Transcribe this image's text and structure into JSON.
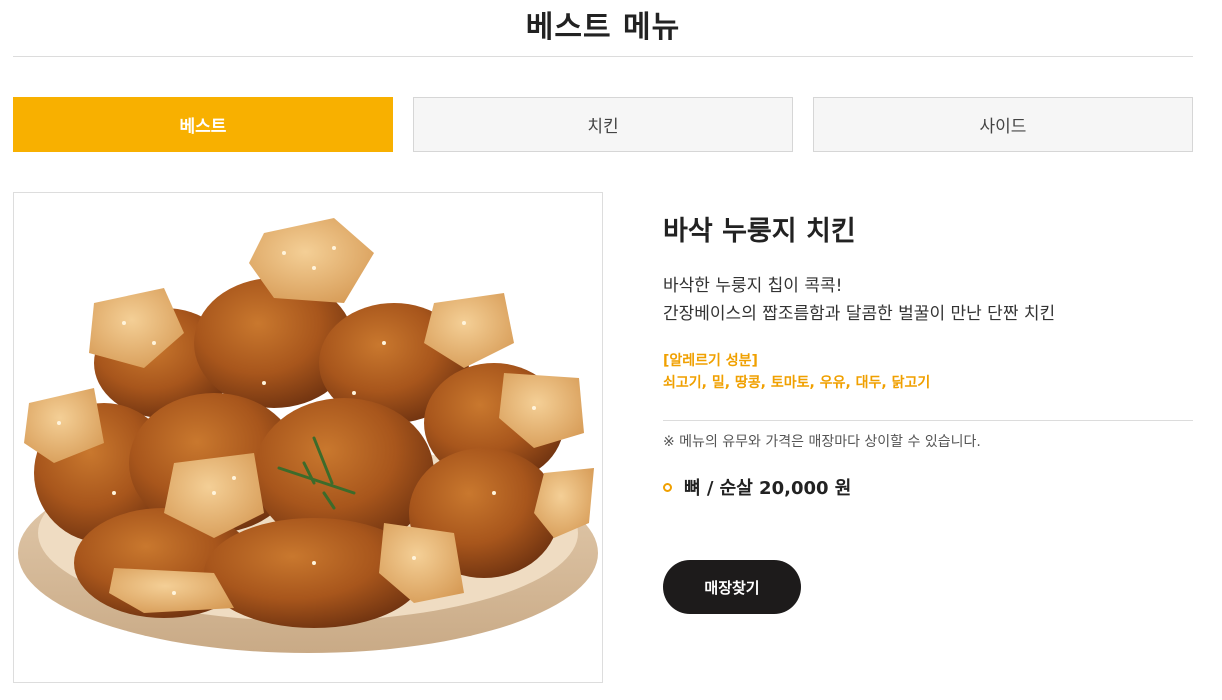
{
  "page": {
    "title": "베스트 메뉴"
  },
  "tabs": [
    {
      "label": "베스트",
      "active": true
    },
    {
      "label": "치킨",
      "active": false
    },
    {
      "label": "사이드",
      "active": false
    }
  ],
  "menu": {
    "name": "바삭 누룽지 치킨",
    "description": [
      "바삭한 누룽지 칩이 콕콕!",
      "간장베이스의 짭조름함과 달콤한 벌꿀이 만난 단짠 치킨"
    ],
    "allergy_title": "[알레르기 성분]",
    "allergy_items": "쇠고기, 밀, 땅콩, 토마토, 우유, 대두, 닭고기",
    "notice": "※ 메뉴의 유무와 가격은 매장마다 상이할 수 있습니다.",
    "price": "뼈 / 순살 20,000 원",
    "find_store_label": "매장찾기"
  },
  "colors": {
    "accent": "#f8b000",
    "allergy_text": "#f0a000",
    "button_bg": "#1d1b1b",
    "tab_inactive_bg": "#f6f6f6"
  },
  "icons": {
    "price_bullet": "circle-bullet-icon"
  }
}
